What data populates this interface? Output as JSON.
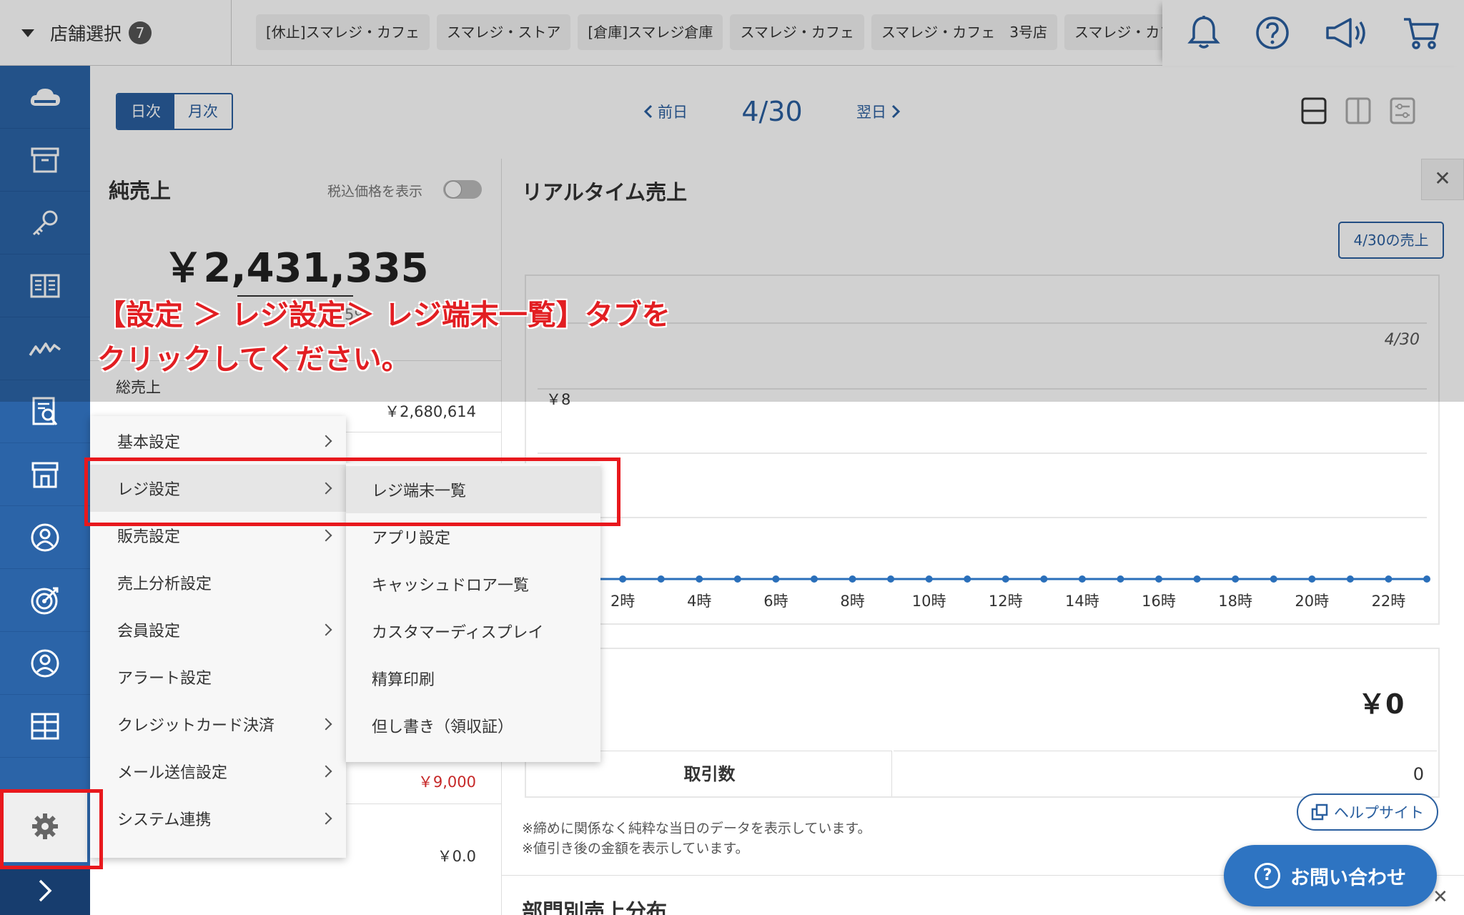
{
  "topbar": {
    "store_select_label": "店舗選択",
    "store_count": "7",
    "store_tabs": [
      "[休止]スマレジ・カフェ",
      "スマレジ・ストア",
      "[倉庫]スマレジ倉庫",
      "スマレジ・カフェ",
      "スマレジ・カフェ　3号店",
      "スマレジ・カフェ"
    ],
    "icons": [
      "bell-icon",
      "help-icon",
      "megaphone-icon",
      "cart-icon"
    ]
  },
  "sidebar": {
    "icons": [
      "cloud-icon",
      "archive-icon",
      "key-icon",
      "book-icon",
      "chart-line-icon",
      "report-icon",
      "store-icon",
      "staff-icon",
      "target-icon",
      "member-icon",
      "grid-icon",
      "settings-icon",
      "expand-icon"
    ]
  },
  "header": {
    "toggle_day": "日次",
    "toggle_month": "月次",
    "prev": "前日",
    "current_date": "4/30",
    "next": "翌日"
  },
  "left_panel": {
    "title": "純売上",
    "tax_toggle_label": "税込価格を表示",
    "net_sales": "￥2,431,335",
    "partial_text": "59",
    "gross_label": "総売上",
    "gross_value": "￥2,680,614",
    "discount_value": "￥9,000",
    "zero_value": "￥0.0"
  },
  "right_panel": {
    "title": "リアルタイム売上",
    "sales_button": "4/30の売上",
    "total": "￥0",
    "count_label": "取引数",
    "count_value": "0",
    "note1": "※締めに関係なく純粋な当日のデータを表示しています。",
    "note2": "※値引き後の金額を表示しています。",
    "bottom_title": "部門別売上分布"
  },
  "chart_data": {
    "type": "line",
    "legend": "4/30",
    "y_tick_visible": "￥8",
    "x_ticks": [
      "2時",
      "4時",
      "6時",
      "8時",
      "10時",
      "12時",
      "14時",
      "16時",
      "18時",
      "20時",
      "22時"
    ],
    "x": [
      0,
      1,
      2,
      3,
      4,
      5,
      6,
      7,
      8,
      9,
      10,
      11,
      12,
      13,
      14,
      15,
      16,
      17,
      18,
      19,
      20,
      21,
      22,
      23
    ],
    "values": [
      0,
      0,
      0,
      0,
      0,
      0,
      0,
      0,
      0,
      0,
      0,
      0,
      0,
      0,
      0,
      0,
      0,
      0,
      0,
      0,
      0,
      0,
      0,
      0
    ],
    "color": "#2a6fba"
  },
  "menu": {
    "items": [
      {
        "label": "基本設定",
        "has_sub": true
      },
      {
        "label": "レジ設定",
        "has_sub": true
      },
      {
        "label": "販売設定",
        "has_sub": true
      },
      {
        "label": "売上分析設定",
        "has_sub": false
      },
      {
        "label": "会員設定",
        "has_sub": true
      },
      {
        "label": "アラート設定",
        "has_sub": false
      },
      {
        "label": "クレジットカード決済",
        "has_sub": true
      },
      {
        "label": "メール送信設定",
        "has_sub": true
      },
      {
        "label": "システム連携",
        "has_sub": true
      }
    ],
    "submenu": [
      "レジ端末一覧",
      "アプリ設定",
      "キャッシュドロア一覧",
      "カスタマーディスプレイ",
      "精算印刷",
      "但し書き（領収証）"
    ]
  },
  "annotation": {
    "line1": "【設定 ＞ レジ設定＞ レジ端末一覧】タブを",
    "line2": "クリックしてください。",
    "color": "#e21e22"
  },
  "floating": {
    "help_site": "ヘルプサイト",
    "contact": "お問い合わせ"
  },
  "colors": {
    "brand_blue": "#2b64a8",
    "highlight_red": "#e8181d"
  }
}
